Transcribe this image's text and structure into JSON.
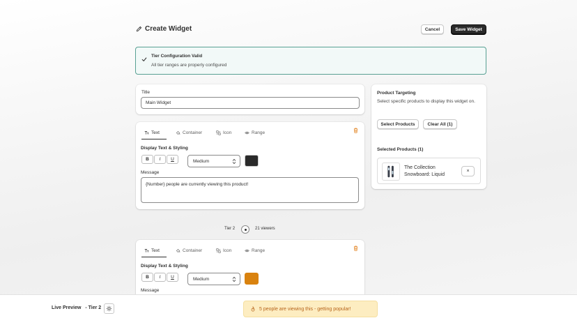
{
  "header": {
    "title": "Create Widget",
    "cancel_label": "Cancel",
    "save_label": "Save Widget"
  },
  "banner": {
    "title": "Tier Configuration Valid",
    "text": "All tier ranges are properly configured"
  },
  "title_card": {
    "label": "Title",
    "value": "Main Widget"
  },
  "tabs": [
    "Text",
    "Container",
    "Icon",
    "Range"
  ],
  "tier1": {
    "section_label": "Display Text & Styling",
    "bold": "B",
    "italic": "I",
    "underline": "U",
    "size": "Medium",
    "color": "#2a2a2a",
    "message_label": "Message",
    "message": "{Number} people are currently viewing this product!"
  },
  "tier_divider": {
    "tier": "Tier 2",
    "viewers": "21 viewers"
  },
  "tier2": {
    "section_label": "Display Text & Styling",
    "bold": "B",
    "italic": "I",
    "underline": "U",
    "size": "Medium",
    "color": "#d9820f",
    "message_label": "Message"
  },
  "product": {
    "title": "Product Targeting",
    "desc": "Select specific products to display this widget on.",
    "select_label": "Select Products",
    "clear_label": "Clear All (1)",
    "selected_title": "Selected Products (1)",
    "item_name": "The Collection Snowboard: Liquid",
    "remove_label": "×"
  },
  "footer": {
    "live_preview": "Live Preview",
    "tier": "- Tier 2",
    "preview_text": "5 people are viewing this - getting popular!"
  },
  "colors": {
    "accent_border": "#58a093",
    "preview_bg": "#fdedc1",
    "preview_text": "#b7641a",
    "trash": "#e07a10"
  }
}
